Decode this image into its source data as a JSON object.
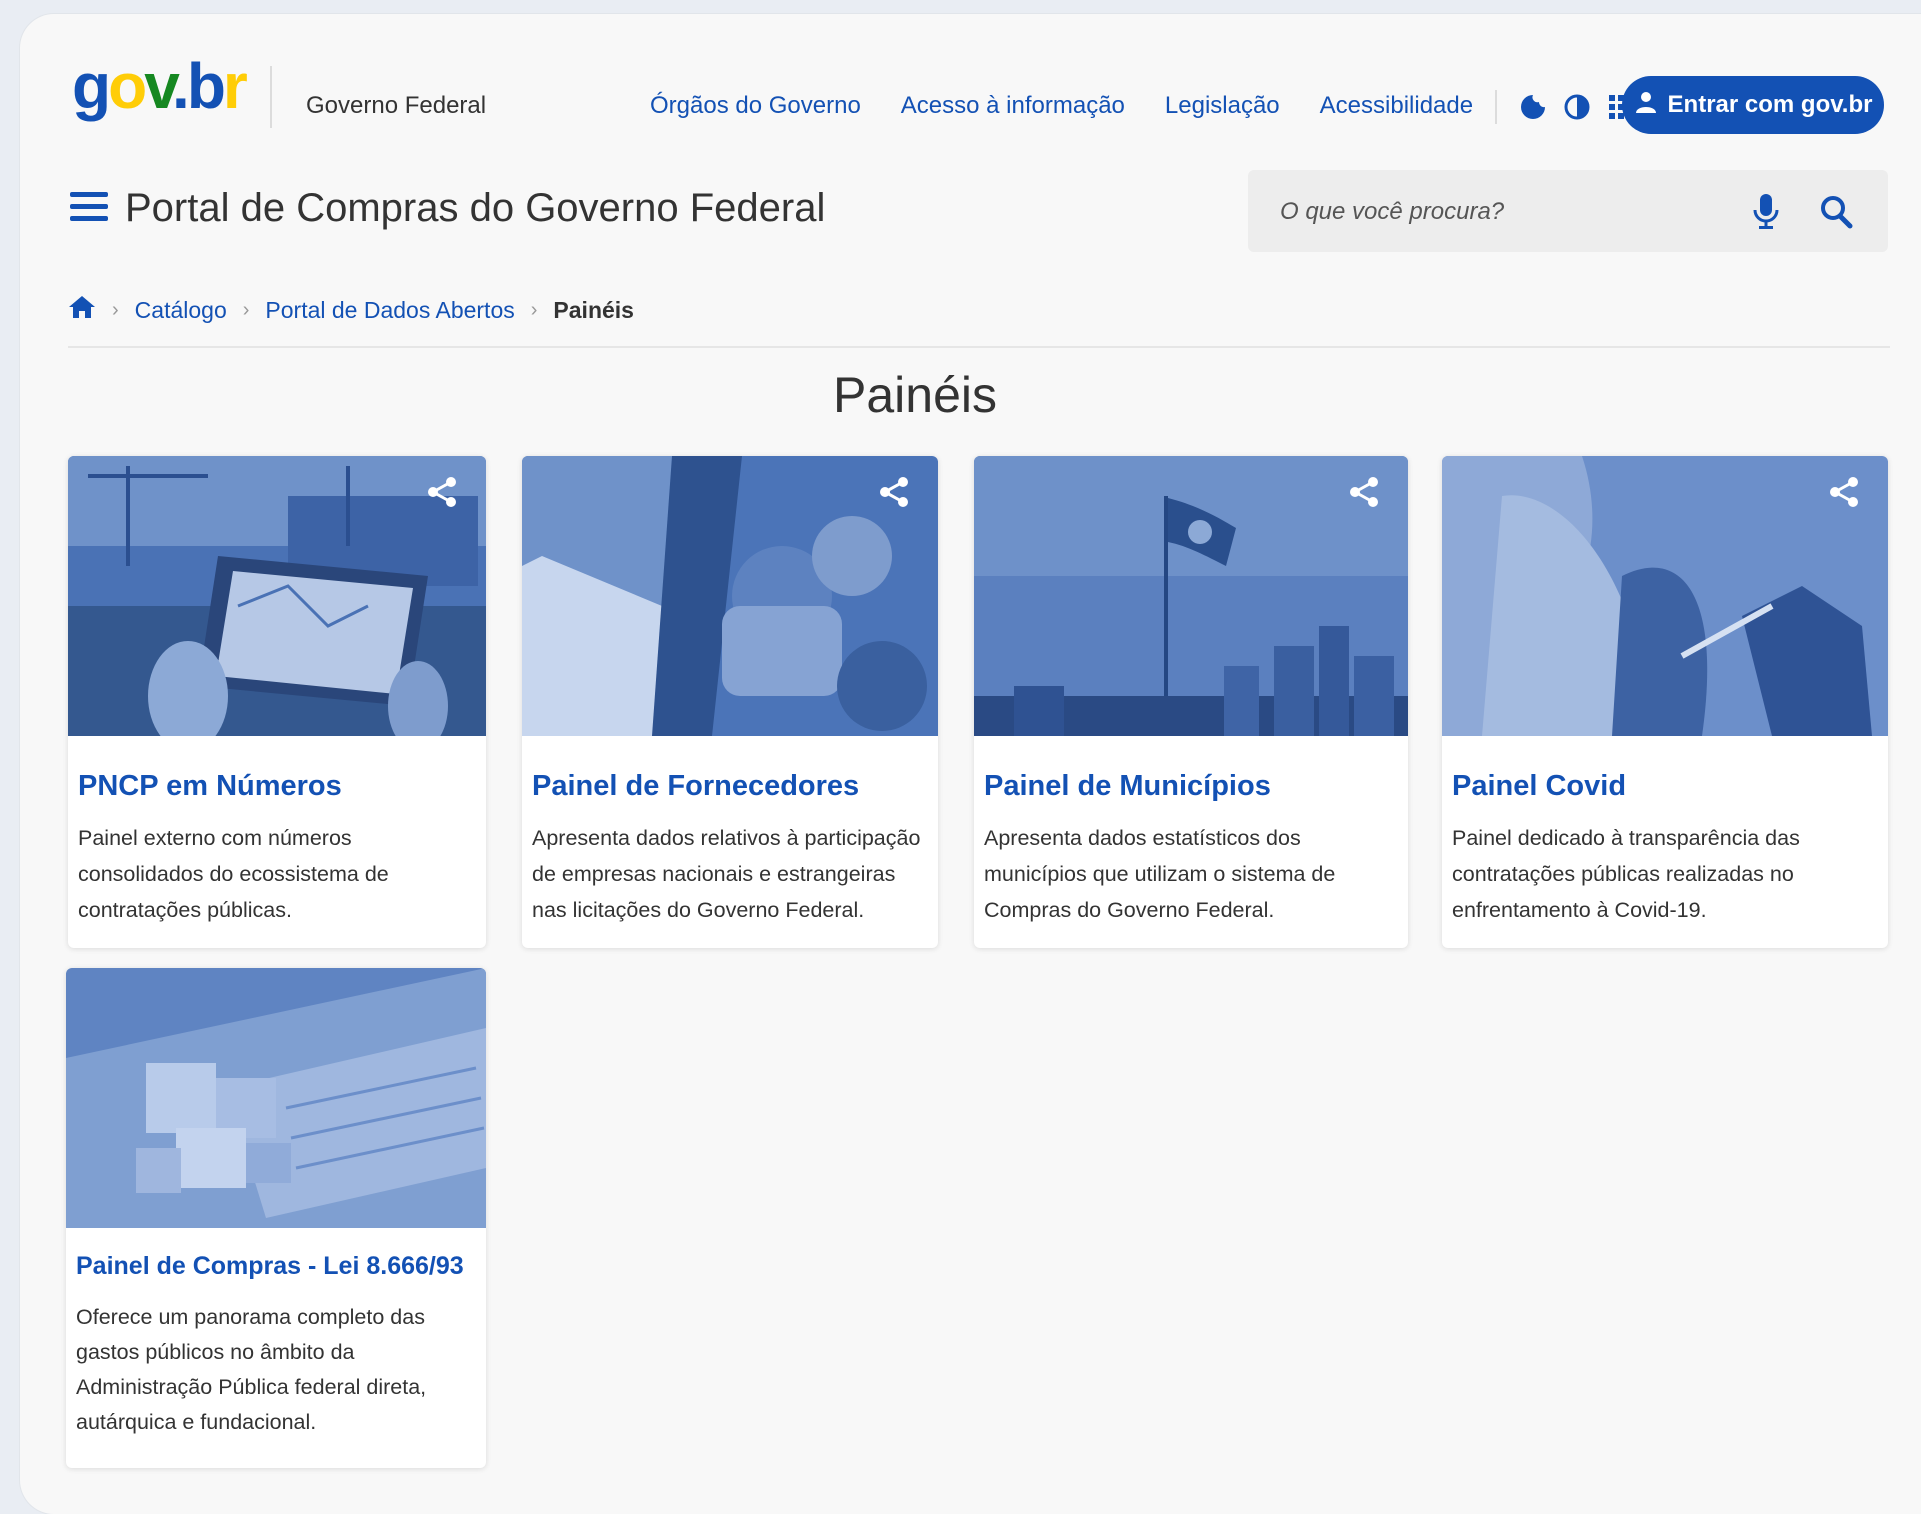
{
  "header": {
    "logo": {
      "g": "g",
      "o": "o",
      "v": "v",
      "dot": ".",
      "b": "b",
      "r": "r"
    },
    "org_name": "Governo Federal",
    "links": [
      "Órgãos do Governo",
      "Acesso à informação",
      "Legislação",
      "Acessibilidade"
    ],
    "login_label": "Entrar com gov.br"
  },
  "site": {
    "title": "Portal de Compras do Governo Federal",
    "search_placeholder": "O que você procura?"
  },
  "breadcrumb": {
    "items": [
      "Catálogo",
      "Portal de Dados Abertos"
    ],
    "current": "Painéis"
  },
  "page": {
    "title": "Painéis"
  },
  "cards": [
    {
      "title": "PNCP em Números",
      "description": "Painel externo com números consolidados do ecossistema de contratações públicas."
    },
    {
      "title": "Painel de Fornecedores",
      "description": "Apresenta dados relativos à participação de empresas nacionais e estrangeiras nas licitações do Governo Federal."
    },
    {
      "title": "Painel de Municípios",
      "description": "Apresenta dados estatísticos dos municípios que utilizam o sistema de Compras do Governo Federal."
    },
    {
      "title": "Painel Covid",
      "description": "Painel dedicado à transparência das contratações públicas realizadas no enfrentamento à Covid-19."
    },
    {
      "title": "Painel de Compras - Lei 8.666/93",
      "description": "Oferece um panorama completo das gastos públicos no âmbito da Administração Pública federal direta, autárquica e fundacional."
    }
  ],
  "colors": {
    "primary": "#1351b4",
    "image_tint": "#2f5da8",
    "text": "#333333"
  }
}
